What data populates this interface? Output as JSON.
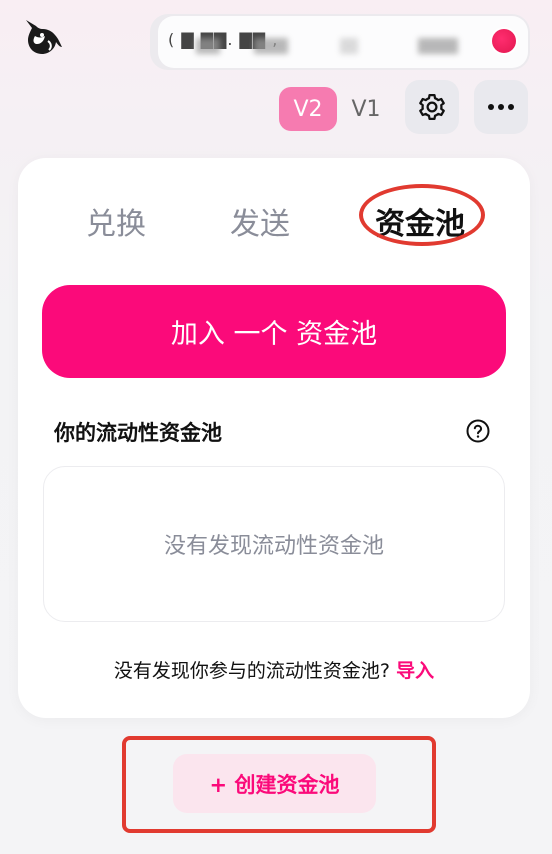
{
  "header": {
    "logo_icon": "uniswap-unicorn-icon",
    "address_text": "( ▇ ▇▇. ▇▇ ,",
    "avatar_icon": "account-avatar-icon"
  },
  "version_switch": {
    "v2_label": "V2",
    "v1_label": "V1",
    "selected": "V2",
    "accent_color": "#f67bb0"
  },
  "toolbar": {
    "settings_icon": "gear-icon",
    "more_icon": "more-dots-icon"
  },
  "tabs": [
    {
      "label": "兑换",
      "active": false
    },
    {
      "label": "发送",
      "active": false
    },
    {
      "label": "资金池",
      "active": true
    }
  ],
  "pool": {
    "join_button_label": "加入 一个 资金池",
    "join_button_color": "#fb0a7a",
    "section_title": "你的流动性资金池",
    "help_icon": "question-circle-icon",
    "empty_text": "没有发现流动性资金池",
    "footer_prefix": "没有发现你参与的流动性资金池?",
    "import_label": "导入"
  },
  "create": {
    "button_label": "+ 创建资金池"
  },
  "annotations": {
    "highlight_color": "#e13a30"
  }
}
